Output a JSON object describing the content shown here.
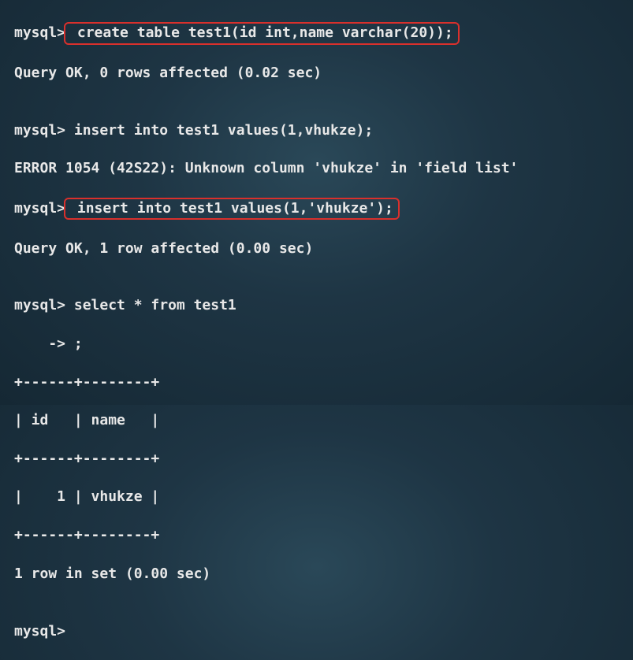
{
  "prompt": "mysql>",
  "cont_prompt": "    ->",
  "lines": {
    "l1_cmd": " create table test1(id int,name varchar(20));",
    "l2": "Query OK, 0 rows affected (0.02 sec)",
    "l3": "",
    "l4": "mysql> insert into test1 values(1,vhukze);",
    "l5": "ERROR 1054 (42S22): Unknown column 'vhukze' in 'field list'",
    "l6_cmd": " insert into test1 values(1,'vhukze');",
    "l7": "Query OK, 1 row affected (0.00 sec)",
    "l8": "",
    "l9": "mysql> select * from test1",
    "l10": "    -> ;",
    "l11": "+------+--------+",
    "l12": "| id   | name   |",
    "l13": "+------+--------+",
    "l14": "|    1 | vhukze |",
    "l15": "+------+--------+",
    "l16": "1 row in set (0.00 sec)",
    "l17": "",
    "l18": "mysql>"
  }
}
